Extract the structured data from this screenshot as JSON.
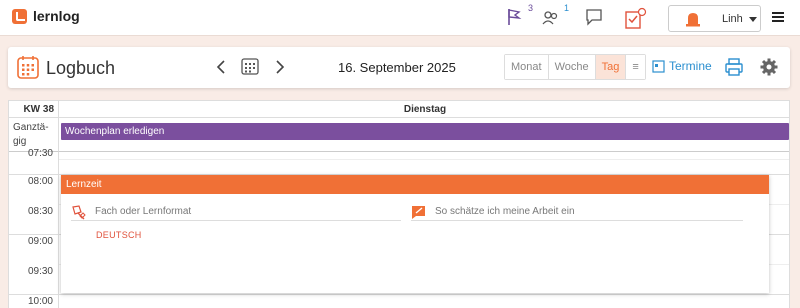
{
  "app": {
    "name": "lernlog"
  },
  "topbar": {
    "flag_count": "3",
    "people_count": "1",
    "user_name": "Linh"
  },
  "header": {
    "title": "Logbuch",
    "date": "16. September 2025",
    "views": [
      "Monat",
      "Woche",
      "Tag",
      "≡"
    ],
    "active_view": "Tag",
    "termine_label": "Termine"
  },
  "calendar": {
    "week_label": "KW 38",
    "day_label": "Dienstag",
    "allday_label": "Ganztä­gig",
    "allday_event": "Wochenplan erledigen",
    "times": [
      "07:30",
      "08:00",
      "08:30",
      "09:00",
      "09:30",
      "10:00"
    ]
  },
  "event": {
    "title": "Lernzeit",
    "field_subject_placeholder": "Fach oder Lernformat",
    "field_self_assessment_placeholder": "So schätze ich meine Arbeit ein",
    "subject_value": "DEUTSCH"
  },
  "colors": {
    "accent": "#f07036",
    "purple": "#7b4f9e",
    "link_blue": "#2b8fcf",
    "background": "#f9ece6"
  }
}
